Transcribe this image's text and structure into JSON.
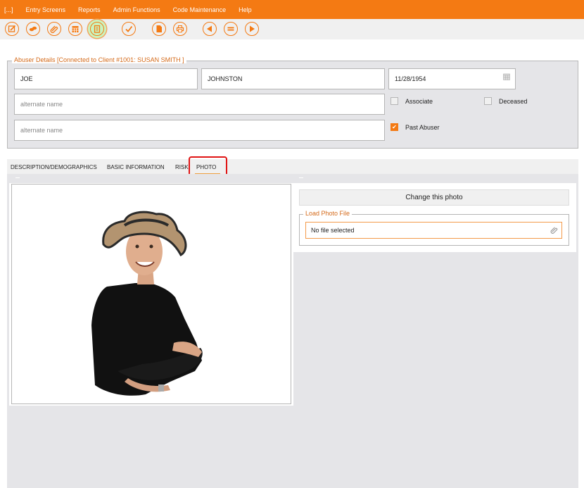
{
  "menu": {
    "items": [
      "[...]",
      "Entry Screens",
      "Reports",
      "Admin Functions",
      "Code Maintenance",
      "Help"
    ]
  },
  "toolbar": {
    "buttons": [
      {
        "icon": "edit-icon",
        "active": false
      },
      {
        "icon": "link-icon",
        "active": false
      },
      {
        "icon": "paperclip-icon",
        "active": false
      },
      {
        "icon": "calendar-icon",
        "active": false
      },
      {
        "icon": "clipboard-icon",
        "active": true
      },
      {
        "icon": "checkmark-icon",
        "active": false
      },
      {
        "icon": "document-icon",
        "active": false
      },
      {
        "icon": "print-icon",
        "active": false
      },
      {
        "icon": "previous-icon",
        "active": false
      },
      {
        "icon": "list-icon",
        "active": false
      },
      {
        "icon": "next-icon",
        "active": false
      }
    ]
  },
  "details": {
    "legend": "Abuser Details [Connected to Client #1001: SUSAN SMITH ]",
    "first_name": "JOE",
    "last_name": "JOHNSTON",
    "dob": "11/28/1954",
    "alternate_name_1_placeholder": "alternate name",
    "alternate_name_2_placeholder": "alternate name",
    "checkboxes": {
      "associate": {
        "label": "Associate",
        "checked": false
      },
      "deceased": {
        "label": "Deceased",
        "checked": false
      },
      "past_abuser": {
        "label": "Past Abuser",
        "checked": true
      }
    }
  },
  "tabs": {
    "items": [
      "DESCRIPTION/DEMOGRAPHICS",
      "BASIC INFORMATION",
      "RISK",
      "PHOTO"
    ],
    "active": "PHOTO"
  },
  "photo": {
    "alt": "Photo of man wearing straw cowboy hat and black t-shirt, arms crossed",
    "change_button": "Change this photo",
    "load_legend": "Load Photo File",
    "file_status": "No file selected"
  },
  "colors": {
    "accent": "#f47a13",
    "highlight": "#e01414",
    "panel_bg": "#e5e5e8"
  }
}
